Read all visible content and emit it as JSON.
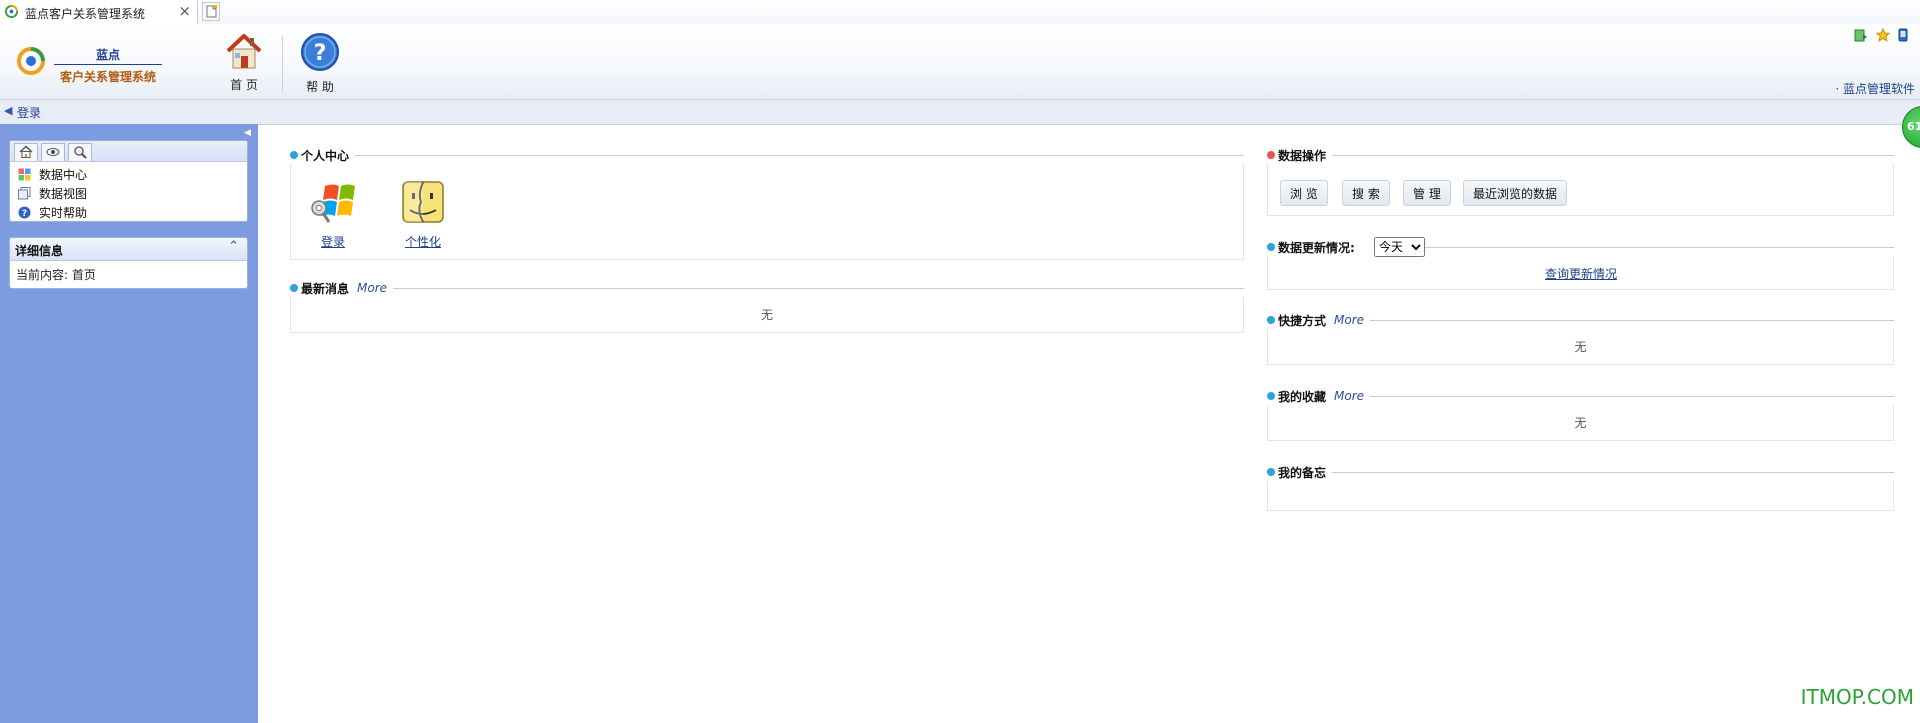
{
  "browser": {
    "tab_title": "蓝点客户关系管理系统",
    "close_glyph": "×"
  },
  "header": {
    "brand_line1": "蓝点",
    "brand_line2": "客户关系管理系统",
    "home_label": "首 页",
    "help_label": "帮 助",
    "top_link": "· 蓝点管理软件"
  },
  "breadcrumb": {
    "arrow": "◀",
    "label": "登录"
  },
  "sidebar": {
    "nav_items": [
      {
        "label": "数据中心",
        "icon": "grid-icon"
      },
      {
        "label": "数据视图",
        "icon": "pages-icon"
      },
      {
        "label": "实时帮助",
        "icon": "help-icon"
      }
    ],
    "detail": {
      "title": "详细信息",
      "content": "当前内容: 首页"
    }
  },
  "main": {
    "personal_center": {
      "title": "个人中心",
      "items": [
        {
          "label": "登录"
        },
        {
          "label": "个性化"
        }
      ]
    },
    "latest_news": {
      "title": "最新消息",
      "more": "More",
      "empty": "无"
    },
    "data_ops": {
      "title": "数据操作",
      "buttons": [
        "浏 览",
        "搜 索",
        "管 理",
        "最近浏览的数据"
      ]
    },
    "data_update": {
      "title": "数据更新情况:",
      "selected": "今天",
      "link": "查询更新情况"
    },
    "shortcuts": {
      "title": "快捷方式",
      "more": "More",
      "empty": "无"
    },
    "favorites": {
      "title": "我的收藏",
      "more": "More",
      "empty": "无"
    },
    "memo": {
      "title": "我的备忘"
    }
  },
  "badge": {
    "value": "61"
  },
  "watermark": "ITMOP.COM",
  "colors": {
    "sidebar_bg": "#7d9be0",
    "accent_blue": "#2d56b3",
    "dot_blue": "#2aa3e6",
    "dot_red": "#ee5050",
    "watermark_green": "#2ca232"
  }
}
